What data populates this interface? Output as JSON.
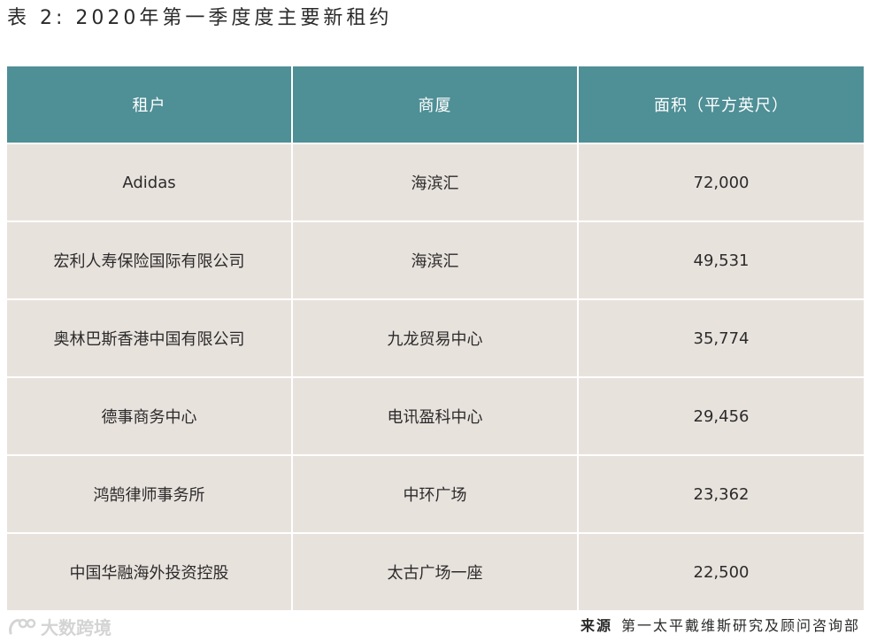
{
  "title": "表 2: 2020年第一季度度主要新租约",
  "table": {
    "headers": [
      "租户",
      "商厦",
      "面积（平方英尺）"
    ],
    "rows": [
      {
        "tenant": "Adidas",
        "building": "海滨汇",
        "area": "72,000"
      },
      {
        "tenant": "宏利人寿保险国际有限公司",
        "building": "海滨汇",
        "area": "49,531"
      },
      {
        "tenant": "奥林巴斯香港中国有限公司",
        "building": "九龙贸易中心",
        "area": "35,774"
      },
      {
        "tenant": "德事商务中心",
        "building": "电讯盈科中心",
        "area": "29,456"
      },
      {
        "tenant": "鸿鹄律师事务所",
        "building": "中环广场",
        "area": "23,362"
      },
      {
        "tenant": "中国华融海外投资控股",
        "building": "太古广场一座",
        "area": "22,500"
      }
    ]
  },
  "colors": {
    "header_bg": "#4f8f96",
    "row_bg": "#e8e2dd"
  },
  "watermark": {
    "text": "大数跨境",
    "icon": "logo-icon"
  },
  "source": {
    "label": "来源",
    "text": "第一太平戴维斯研究及顾问咨询部"
  }
}
